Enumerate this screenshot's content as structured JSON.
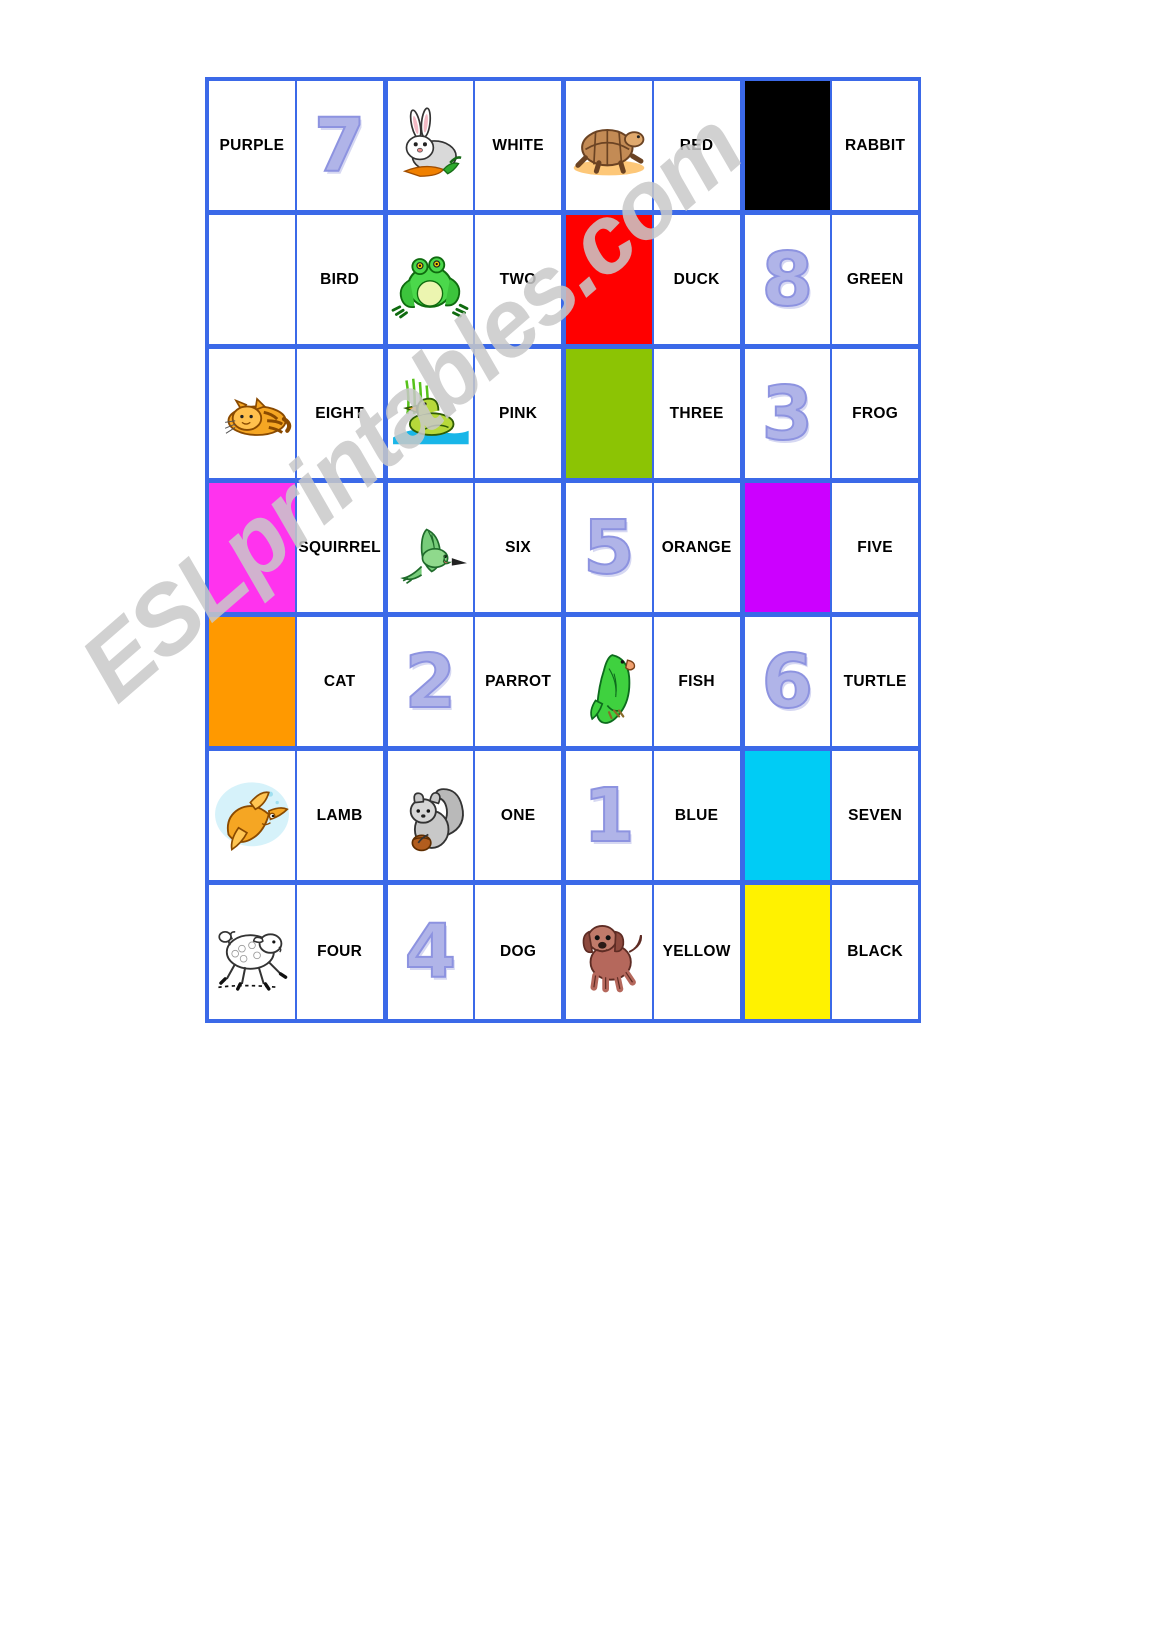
{
  "watermark": {
    "text": "ESLprintables.com"
  },
  "board": {
    "border_color": "#3b69e8",
    "palette": {
      "black": "#000000",
      "white": "#ffffff",
      "red": "#ff0000",
      "green": "#8cc404",
      "pink": "#ff33ee",
      "purple": "#cc00ff",
      "orange": "#ff9900",
      "blue": "#00ccf5",
      "yellow": "#fff200"
    },
    "rows": [
      {
        "dominoes": [
          {
            "left": {
              "kind": "word",
              "value": "PURPLE"
            },
            "right": {
              "kind": "number",
              "value": "7"
            }
          },
          {
            "left": {
              "kind": "picture",
              "value": "rabbit-picture"
            },
            "right": {
              "kind": "word",
              "value": "WHITE"
            }
          },
          {
            "left": {
              "kind": "picture",
              "value": "turtle-picture"
            },
            "right": {
              "kind": "word",
              "value": "RED"
            }
          },
          {
            "left": {
              "kind": "color",
              "value": "#000000",
              "name": "black-swatch"
            },
            "right": {
              "kind": "word",
              "value": "RABBIT"
            }
          }
        ]
      },
      {
        "dominoes": [
          {
            "left": {
              "kind": "color",
              "value": "#ffffff",
              "name": "white-swatch"
            },
            "right": {
              "kind": "word",
              "value": "BIRD"
            }
          },
          {
            "left": {
              "kind": "picture",
              "value": "frog-picture"
            },
            "right": {
              "kind": "word",
              "value": "TWO"
            }
          },
          {
            "left": {
              "kind": "color",
              "value": "#ff0000",
              "name": "red-swatch"
            },
            "right": {
              "kind": "word",
              "value": "DUCK"
            }
          },
          {
            "left": {
              "kind": "number",
              "value": "8"
            },
            "right": {
              "kind": "word",
              "value": "GREEN"
            }
          }
        ]
      },
      {
        "dominoes": [
          {
            "left": {
              "kind": "picture",
              "value": "cat-picture"
            },
            "right": {
              "kind": "word",
              "value": "EIGHT"
            }
          },
          {
            "left": {
              "kind": "picture",
              "value": "duck-picture"
            },
            "right": {
              "kind": "word",
              "value": "PINK"
            }
          },
          {
            "left": {
              "kind": "color",
              "value": "#8cc404",
              "name": "green-swatch"
            },
            "right": {
              "kind": "word",
              "value": "THREE"
            }
          },
          {
            "left": {
              "kind": "number",
              "value": "3"
            },
            "right": {
              "kind": "word",
              "value": "FROG"
            }
          }
        ]
      },
      {
        "dominoes": [
          {
            "left": {
              "kind": "color",
              "value": "#ff33ee",
              "name": "pink-swatch"
            },
            "right": {
              "kind": "word",
              "value": "SQUIRREL"
            }
          },
          {
            "left": {
              "kind": "picture",
              "value": "hummingbird-picture"
            },
            "right": {
              "kind": "word",
              "value": "SIX"
            }
          },
          {
            "left": {
              "kind": "number",
              "value": "5"
            },
            "right": {
              "kind": "word",
              "value": "ORANGE"
            }
          },
          {
            "left": {
              "kind": "color",
              "value": "#cc00ff",
              "name": "purple-swatch"
            },
            "right": {
              "kind": "word",
              "value": "FIVE"
            }
          }
        ]
      },
      {
        "dominoes": [
          {
            "left": {
              "kind": "color",
              "value": "#ff9900",
              "name": "orange-swatch"
            },
            "right": {
              "kind": "word",
              "value": "CAT"
            }
          },
          {
            "left": {
              "kind": "number",
              "value": "2"
            },
            "right": {
              "kind": "word",
              "value": "PARROT"
            }
          },
          {
            "left": {
              "kind": "picture",
              "value": "parrot-picture"
            },
            "right": {
              "kind": "word",
              "value": "FISH"
            }
          },
          {
            "left": {
              "kind": "number",
              "value": "6"
            },
            "right": {
              "kind": "word",
              "value": "TURTLE"
            }
          }
        ]
      },
      {
        "dominoes": [
          {
            "left": {
              "kind": "picture",
              "value": "goldfish-picture"
            },
            "right": {
              "kind": "word",
              "value": "LAMB"
            }
          },
          {
            "left": {
              "kind": "picture",
              "value": "squirrel-picture"
            },
            "right": {
              "kind": "word",
              "value": "ONE"
            }
          },
          {
            "left": {
              "kind": "number",
              "value": "1"
            },
            "right": {
              "kind": "word",
              "value": "BLUE"
            }
          },
          {
            "left": {
              "kind": "color",
              "value": "#00ccf5",
              "name": "blue-swatch"
            },
            "right": {
              "kind": "word",
              "value": "SEVEN"
            }
          }
        ]
      },
      {
        "dominoes": [
          {
            "left": {
              "kind": "picture",
              "value": "lamb-picture"
            },
            "right": {
              "kind": "word",
              "value": "FOUR"
            }
          },
          {
            "left": {
              "kind": "number",
              "value": "4"
            },
            "right": {
              "kind": "word",
              "value": "DOG"
            }
          },
          {
            "left": {
              "kind": "picture",
              "value": "dog-picture"
            },
            "right": {
              "kind": "word",
              "value": "YELLOW"
            }
          },
          {
            "left": {
              "kind": "color",
              "value": "#fff200",
              "name": "yellow-swatch"
            },
            "right": {
              "kind": "word",
              "value": "BLACK"
            }
          }
        ]
      }
    ]
  }
}
